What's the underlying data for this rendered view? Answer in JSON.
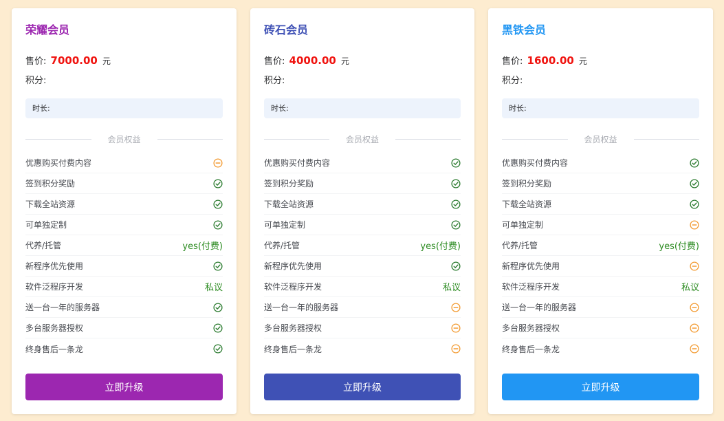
{
  "colors": {
    "check": "#2e7d32",
    "minus": "#f39c34"
  },
  "labels": {
    "price_prefix": "售价:",
    "price_unit": "元",
    "points_prefix": "积分:",
    "duration_prefix": "时长:",
    "divider": "会员权益",
    "button": "立即升级"
  },
  "benefit_names": [
    "优惠购买付费内容",
    "签到积分奖励",
    "下载全站资源",
    "可单独定制",
    "代养/托管",
    "新程序优先使用",
    "软件泛程序开发",
    "送一台一年的服务器",
    "多台服务器授权",
    "终身售后一条龙"
  ],
  "cards": [
    {
      "name": "荣耀会员",
      "title_color": "#9c27b0",
      "button_color": "#9c27b0",
      "price": "7000.00",
      "points": "",
      "duration": "",
      "benefits": [
        {
          "type": "minus-icon"
        },
        {
          "type": "check-icon"
        },
        {
          "type": "check-icon"
        },
        {
          "type": "check-icon"
        },
        {
          "type": "text",
          "text": "yes(付费)"
        },
        {
          "type": "check-icon"
        },
        {
          "type": "text",
          "text": "私议"
        },
        {
          "type": "check-icon"
        },
        {
          "type": "check-icon"
        },
        {
          "type": "check-icon"
        }
      ]
    },
    {
      "name": "砖石会员",
      "title_color": "#3f51b5",
      "button_color": "#3f51b5",
      "price": "4000.00",
      "points": "",
      "duration": "",
      "benefits": [
        {
          "type": "check-icon"
        },
        {
          "type": "check-icon"
        },
        {
          "type": "check-icon"
        },
        {
          "type": "check-icon"
        },
        {
          "type": "text",
          "text": "yes(付费)"
        },
        {
          "type": "check-icon"
        },
        {
          "type": "text",
          "text": "私议"
        },
        {
          "type": "minus-icon"
        },
        {
          "type": "minus-icon"
        },
        {
          "type": "minus-icon"
        }
      ]
    },
    {
      "name": "黑铁会员",
      "title_color": "#2196f3",
      "button_color": "#2196f3",
      "price": "1600.00",
      "points": "",
      "duration": "",
      "benefits": [
        {
          "type": "check-icon"
        },
        {
          "type": "check-icon"
        },
        {
          "type": "check-icon"
        },
        {
          "type": "minus-icon"
        },
        {
          "type": "text",
          "text": "yes(付费)"
        },
        {
          "type": "minus-icon"
        },
        {
          "type": "text",
          "text": "私议"
        },
        {
          "type": "minus-icon"
        },
        {
          "type": "minus-icon"
        },
        {
          "type": "minus-icon"
        }
      ]
    }
  ]
}
